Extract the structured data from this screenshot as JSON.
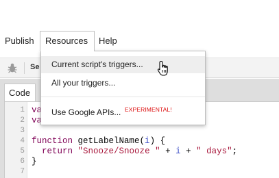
{
  "menubar": {
    "items": [
      {
        "label": "Publish"
      },
      {
        "label": "Resources"
      },
      {
        "label": "Help"
      }
    ]
  },
  "toolbar": {
    "debug_icon": "bug-icon",
    "truncated_label": "Se"
  },
  "editor": {
    "tab_label": "Code",
    "line_numbers": [
      "1",
      "2",
      "3",
      "4",
      "5",
      "6",
      "7"
    ],
    "lines": [
      {
        "prefix": "va"
      },
      {
        "prefix": "va"
      },
      {
        "text": ""
      },
      {
        "keyword": "function",
        "name": " getLabelName(",
        "param": "i",
        "tail": ") {"
      },
      {
        "indent": "  ",
        "keyword": "return",
        "string1": "\"Snooze/Snooze \"",
        "op1": " + ",
        "var": "i",
        "op2": " + ",
        "string2": "\" days\"",
        "end": ";"
      },
      {
        "text": "}"
      },
      {
        "text": ""
      }
    ]
  },
  "resources_menu": {
    "items": [
      {
        "label": "Current script's triggers..."
      },
      {
        "label": "All your triggers..."
      },
      {
        "label": "Use Google APIs...",
        "badge": "EXPERIMENTAL!"
      }
    ]
  },
  "colors": {
    "keyword": "#7f0055",
    "string": "#a8173b",
    "variable": "#3c4ec7",
    "badge": "#dd1111"
  },
  "cursor_icon": "hand-pointer-icon"
}
